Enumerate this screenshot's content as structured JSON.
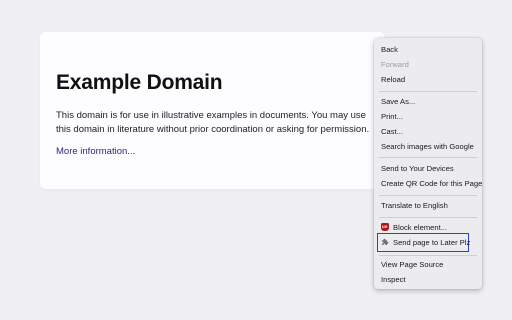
{
  "page": {
    "heading": "Example Domain",
    "paragraph": "This domain is for use in illustrative examples in documents. You may use this domain in literature without prior coordination or asking for permission.",
    "link": "More information..."
  },
  "context_menu": {
    "back": "Back",
    "forward": "Forward",
    "reload": "Reload",
    "save_as": "Save As...",
    "print": "Print...",
    "cast": "Cast...",
    "search_images": "Search images with Google",
    "send_devices": "Send to Your Devices",
    "qr_code": "Create QR Code for this Page",
    "translate": "Translate to English",
    "block_element": "Block element...",
    "send_later": "Send page to Later Plz",
    "view_source": "View Page Source",
    "inspect": "Inspect"
  },
  "icons": {
    "block_element": "ublock-origin-icon",
    "send_later": "puzzle-piece-extension-icon"
  },
  "colors": {
    "highlight_border": "#2d3ee0",
    "link": "#2a2a7a",
    "ublock_red": "#b0161b"
  }
}
